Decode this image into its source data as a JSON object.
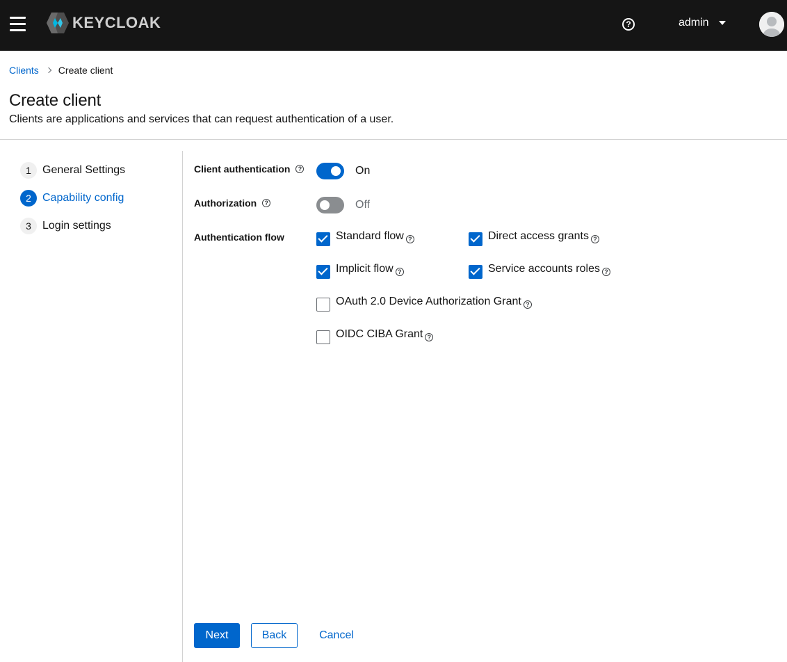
{
  "header": {
    "logo_text": "KEYCLOAK",
    "username": "admin"
  },
  "breadcrumb": {
    "parent": "Clients",
    "current": "Create client"
  },
  "page": {
    "title": "Create client",
    "description": "Clients are applications and services that can request authentication of a user."
  },
  "wizard": {
    "steps": [
      {
        "number": "1",
        "label": "General Settings",
        "active": false
      },
      {
        "number": "2",
        "label": "Capability config",
        "active": true
      },
      {
        "number": "3",
        "label": "Login settings",
        "active": false
      }
    ]
  },
  "form": {
    "client_authentication": {
      "label": "Client authentication",
      "state": "On",
      "value": true
    },
    "authorization": {
      "label": "Authorization",
      "state": "Off",
      "value": false
    },
    "authentication_flow": {
      "label": "Authentication flow",
      "options": [
        {
          "label": "Standard flow",
          "checked": true
        },
        {
          "label": "Direct access grants",
          "checked": true
        },
        {
          "label": "Implicit flow",
          "checked": true
        },
        {
          "label": "Service accounts roles",
          "checked": true
        },
        {
          "label": "OAuth 2.0 Device Authorization Grant",
          "checked": false
        },
        {
          "label": "OIDC CIBA Grant",
          "checked": false
        }
      ]
    }
  },
  "footer": {
    "next_label": "Next",
    "back_label": "Back",
    "cancel_label": "Cancel"
  },
  "colors": {
    "masthead": "#151515",
    "primary": "#0066cc"
  }
}
